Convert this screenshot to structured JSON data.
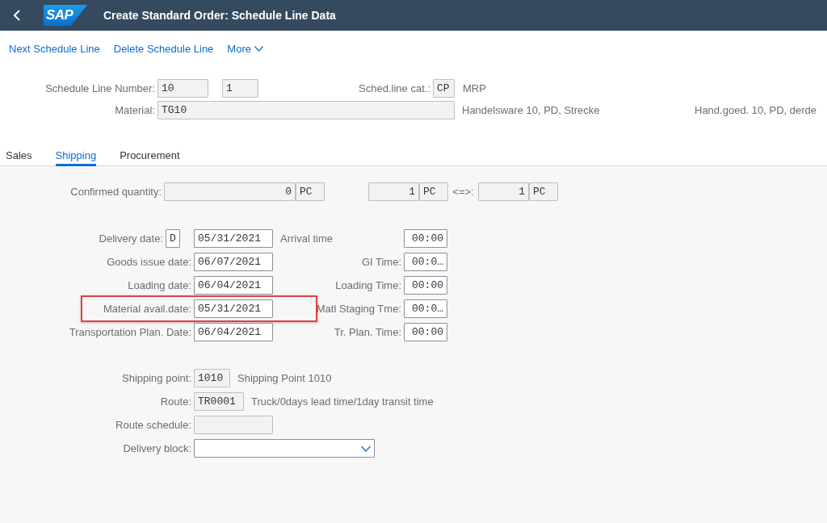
{
  "shell": {
    "logo": "SAP",
    "title": "Create Standard Order: Schedule Line Data"
  },
  "toolbar": {
    "actions": [
      {
        "label": "Next Schedule Line",
        "kind": "link"
      },
      {
        "label": "Delete Schedule Line",
        "kind": "link"
      },
      {
        "label": "More",
        "kind": "menu"
      }
    ]
  },
  "header": {
    "schedule_line_number": {
      "label": "Schedule Line Number:",
      "fields": [
        {
          "value": "10",
          "readonly": true
        },
        {
          "value": "1",
          "readonly": true
        }
      ]
    },
    "sched_line_cat": {
      "label": "Sched.line cat.:",
      "value": "CP",
      "readonly": true,
      "description": "MRP"
    },
    "material": {
      "label": "Material:",
      "value": "TG10",
      "readonly": true,
      "description": "Handelsware 10, PD, Strecke",
      "description_2": "Hand.goed. 10, PD, derde"
    }
  },
  "tabs": [
    {
      "label": "Sales",
      "selected": false
    },
    {
      "label": "Shipping",
      "selected": true
    },
    {
      "label": "Procurement",
      "selected": false
    }
  ],
  "confirmed_quantity": {
    "label": "Confirmed quantity:",
    "quantity": {
      "value": "0",
      "readonly": true
    },
    "unit": {
      "value": "PC",
      "readonly": true
    },
    "quantity_2": {
      "value": "1",
      "readonly": true
    },
    "unit_2": {
      "value": "PC",
      "readonly": true
    },
    "conversion_label": "<=>:",
    "quantity_3": {
      "value": "1",
      "readonly": true
    },
    "unit_3": {
      "value": "PC",
      "readonly": true
    }
  },
  "dates": {
    "rows": [
      {
        "label": "Delivery date:",
        "indicator": {
          "value": "D",
          "readonly": false
        },
        "value": "05/31/2021",
        "readonly": false,
        "highlighted": false,
        "time_label": {
          "text": "Arrival time",
          "kind": "text"
        },
        "time_value": "00:00"
      },
      {
        "label": "Goods issue date:",
        "value": "06/07/2021",
        "readonly": false,
        "highlighted": false,
        "time_label": {
          "text": "GI Time:",
          "kind": "label"
        },
        "time_value": "00:0…"
      },
      {
        "label": "Loading date:",
        "value": "06/04/2021",
        "readonly": false,
        "highlighted": false,
        "time_label": {
          "text": "Loading Time:",
          "kind": "label"
        },
        "time_value": "00:00"
      },
      {
        "label": "Material avail.date:",
        "value": "05/31/2021",
        "readonly": false,
        "highlighted": true,
        "time_label": {
          "text": "Matl Staging Tme:",
          "kind": "label"
        },
        "time_value": "00:0…"
      },
      {
        "label": "Transportation Plan. Date:",
        "value": "06/04/2021",
        "readonly": false,
        "highlighted": false,
        "time_label": {
          "text": "Tr. Plan. Time:",
          "kind": "label"
        },
        "time_value": "00:00"
      }
    ]
  },
  "shipping": {
    "rows": [
      {
        "label": "Shipping point:",
        "kind": "input",
        "value": "1010",
        "readonly": true,
        "description": "Shipping Point 1010"
      },
      {
        "label": "Route:",
        "kind": "input",
        "value": "TR0001",
        "readonly": true,
        "description": "Truck/0days lead time/1day transit time"
      },
      {
        "label": "Route schedule:",
        "kind": "input",
        "readonly": true
      },
      {
        "label": "Delivery block:",
        "kind": "select",
        "readonly": false
      }
    ]
  }
}
